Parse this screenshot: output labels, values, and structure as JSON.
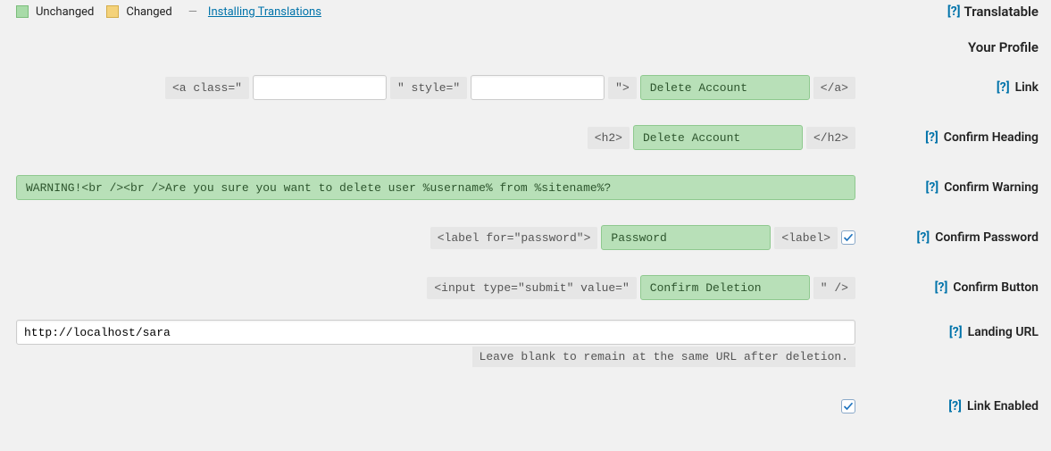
{
  "legend": {
    "unchanged": "Unchanged",
    "changed": "Changed",
    "dash": "—",
    "link_text": "Installing Translations",
    "translatable": "Translatable",
    "help": "[?]"
  },
  "rows": {
    "profile": {
      "label": "Your Profile"
    },
    "link": {
      "label": "Link",
      "tag_open": "<a class=\"",
      "tag_mid": "\" style=\"",
      "tag_end": "\">",
      "tag_close": "</a>",
      "class_val": "",
      "style_val": "",
      "text_val": "Delete Account"
    },
    "heading": {
      "label": "Confirm Heading",
      "tag_open": "<h2>",
      "tag_close": "</h2>",
      "text_val": "Delete Account"
    },
    "warning": {
      "label": "Confirm Warning",
      "text_val": "WARNING!<br /><br />Are you sure you want to delete user %username% from %sitename%?"
    },
    "password": {
      "label": "Confirm Password",
      "tag_open": "<label for=\"password\">",
      "tag_close": "<label>",
      "text_val": "Password",
      "checked": true
    },
    "button": {
      "label": "Confirm Button",
      "tag_open": "<input type=\"submit\" value=\"",
      "tag_close": "\" />",
      "text_val": "Confirm Deletion"
    },
    "landing": {
      "label": "Landing URL",
      "val": "http://localhost/sara",
      "note": "Leave blank to remain at the same URL after deletion."
    },
    "enabled": {
      "label": "Link Enabled",
      "checked": true
    }
  }
}
